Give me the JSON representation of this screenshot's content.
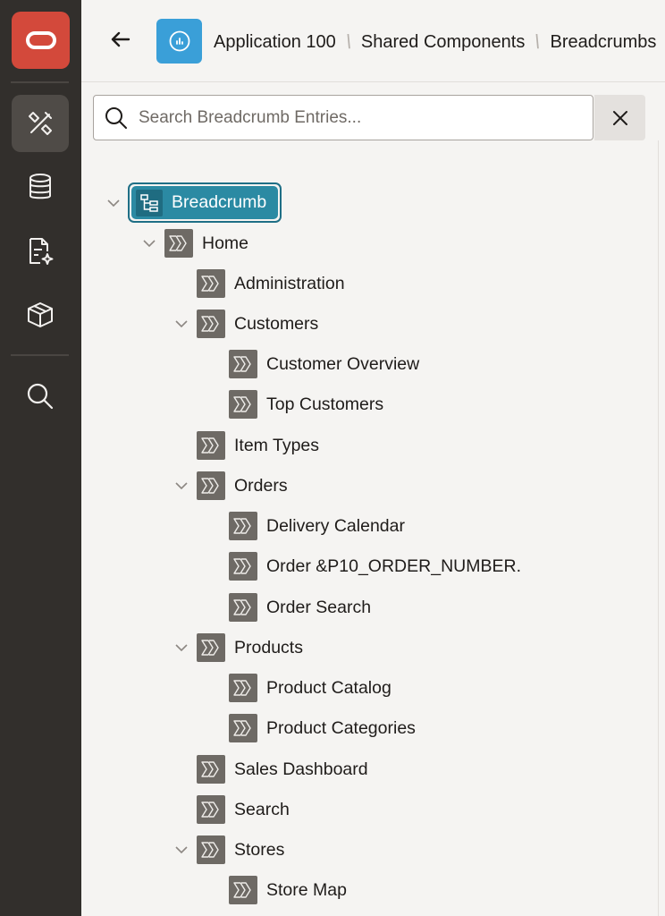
{
  "header": {
    "back_label": "Back",
    "crumbs": [
      "Application 100",
      "Shared Components",
      "Breadcrumbs"
    ]
  },
  "search": {
    "placeholder": "Search Breadcrumb Entries...",
    "value": ""
  },
  "tree": {
    "root": "Breadcrumb",
    "items": [
      "Home",
      "Administration",
      "Customers",
      "Customer Overview",
      "Top Customers",
      "Item Types",
      "Orders",
      "Delivery Calendar",
      "Order &P10_ORDER_NUMBER.",
      "Order Search",
      "Products",
      "Product Catalog",
      "Product Categories",
      "Sales Dashboard",
      "Search",
      "Stores",
      "Store Map"
    ]
  },
  "colors": {
    "rail": "#322f2c",
    "logo": "#d3493b",
    "app_icon": "#3a9fd8",
    "selected_node": "#2b8aa3"
  }
}
